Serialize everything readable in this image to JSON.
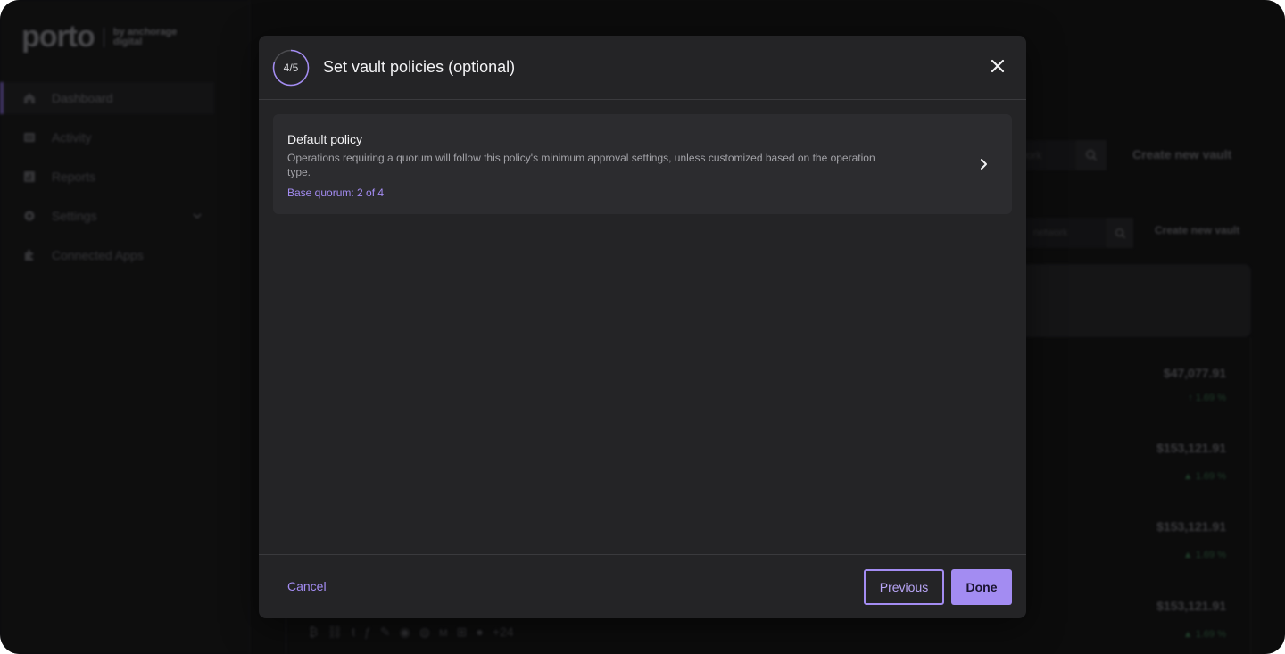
{
  "background": {
    "logo": {
      "word": "porto",
      "by_line1": "by anchorage",
      "by_line2": "digital"
    },
    "nav": [
      {
        "label": "Dashboard",
        "icon": "home-icon",
        "active": true
      },
      {
        "label": "Activity",
        "icon": "list-icon",
        "active": false
      },
      {
        "label": "Reports",
        "icon": "reports-icon",
        "active": false
      },
      {
        "label": "Settings",
        "icon": "gear-icon",
        "active": false,
        "expandable": true
      },
      {
        "label": "Connected Apps",
        "icon": "puzzle-icon",
        "active": false
      }
    ],
    "search_placeholder_1": "work",
    "search_placeholder_2": "network",
    "create_vault_label_1": "Create new vault",
    "create_vault_label_2": "Create new vault",
    "amounts": [
      "$47,077.91",
      "$153,121.91",
      "$153,121.91",
      "$153,121.91"
    ],
    "changes": [
      "1.69 %",
      "1.69 %",
      "1.69 %",
      "1.69 %"
    ],
    "more_assets": "+24"
  },
  "modal": {
    "step": "4/5",
    "step_progress": 0.8,
    "title": "Set vault policies (optional)",
    "policy": {
      "title": "Default policy",
      "description": "Operations requiring a quorum will follow this policy's minimum approval settings, unless customized based on the operation type.",
      "quorum": "Base quorum: 2 of 4"
    },
    "cancel_label": "Cancel",
    "previous_label": "Previous",
    "done_label": "Done"
  },
  "colors": {
    "accent": "#a38cf2",
    "modal_bg": "#242426",
    "card_bg": "#2c2c2f",
    "app_bg": "#121213"
  }
}
